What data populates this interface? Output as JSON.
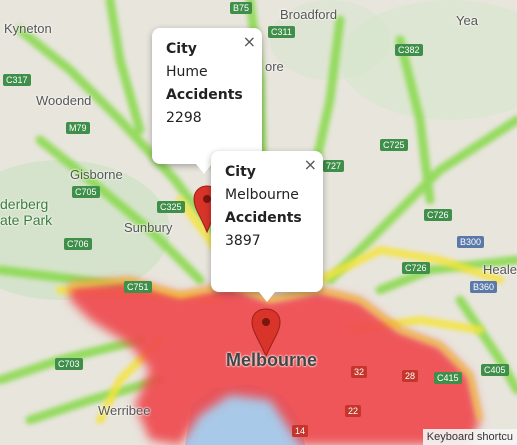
{
  "places": [
    {
      "id": "kyneton",
      "label": "Kyneton"
    },
    {
      "id": "broadford",
      "label": "Broadford"
    },
    {
      "id": "yea",
      "label": "Yea"
    },
    {
      "id": "woodend",
      "label": "Woodend"
    },
    {
      "id": "gisborne",
      "label": "Gisborne"
    },
    {
      "id": "sunbury",
      "label": "Sunbury"
    },
    {
      "id": "melbourne",
      "label": "Melbourne"
    },
    {
      "id": "werribee",
      "label": "Werribee"
    },
    {
      "id": "derberg",
      "label": "derberg"
    },
    {
      "id": "ate-park",
      "label": "ate Park"
    },
    {
      "id": "heale",
      "label": "Heale"
    },
    {
      "id": "ore",
      "label": "ore"
    }
  ],
  "roads": [
    "B75",
    "C311",
    "C382",
    "C317",
    "M79",
    "C725",
    "C705",
    "C325",
    "727",
    "C706",
    "C726",
    "B300",
    "C751",
    "B360",
    "C703",
    "C415",
    "C405",
    "C726",
    "32",
    "28",
    "22",
    "14"
  ],
  "info_hume": {
    "close": "×",
    "city_label": "City",
    "city": "Hume",
    "acc_label": "Accidents",
    "acc": "2298"
  },
  "info_melbourne": {
    "close": "×",
    "city_label": "City",
    "city": "Melbourne",
    "acc_label": "Accidents",
    "acc": "3897"
  },
  "footer": {
    "keyboard": "Keyboard shortcu"
  },
  "colors": {
    "heat_high": "#f0404a",
    "heat_mid": "#f4e43a",
    "heat_low": "#86d94a",
    "marker": "#d8342a"
  }
}
